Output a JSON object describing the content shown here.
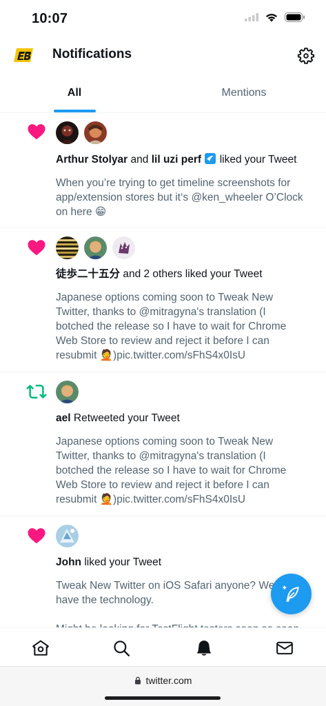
{
  "status_bar": {
    "time": "10:07"
  },
  "header": {
    "title": "Notifications"
  },
  "tabs": {
    "all": "All",
    "mentions": "Mentions"
  },
  "colors": {
    "accent": "#1d9bf0",
    "like": "#f91880",
    "retweet": "#00ba7c",
    "muted": "#536471"
  },
  "notifications": [
    {
      "type": "like",
      "user1": "Arthur Stolyar",
      "and": "and",
      "user2": "lil uzi perf",
      "action": "liked your Tweet",
      "body_lines": [
        "When you’re trying to get timeline screenshots for",
        "app/extension stores but it‘s @ken_wheeler O’Clock",
        "on here 😁"
      ]
    },
    {
      "type": "like",
      "user1": "徒歩二十五分",
      "action": "and 2 others liked your Tweet",
      "body_lines": [
        "Japanese options coming soon to Tweak New",
        "Twitter, thanks to @mitragyna's translation (I",
        "botched the release so I have to wait for Chrome",
        "Web Store to review and reject it before I can",
        "resubmit 🤦)pic.twitter.com/sFhS4x0IsU"
      ]
    },
    {
      "type": "retweet",
      "user1": "ael",
      "action": "Retweeted your Tweet",
      "body_lines": [
        "Japanese options coming soon to Tweak New",
        "Twitter, thanks to @mitragyna's translation (I",
        "botched the release so I have to wait for Chrome",
        "Web Store to review and reject it before I can",
        "resubmit 🤦)pic.twitter.com/sFhS4x0IsU"
      ]
    },
    {
      "type": "like",
      "user1": "John",
      "action": "liked your Tweet",
      "body_lines": [
        "Tweak New Twitter on iOS Safari anyone? We",
        "have the technology.",
        "",
        "Might be looking for TestFlight testers soon so soon"
      ]
    }
  ],
  "browser": {
    "url": "twitter.com"
  }
}
